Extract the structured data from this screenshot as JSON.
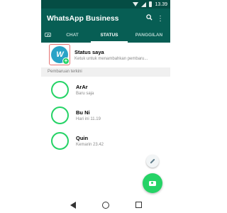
{
  "status_bar": {
    "time": "13.39"
  },
  "app_bar": {
    "title": "WhatsApp Business",
    "search_icon": "🔍",
    "menu_icon": "⋮"
  },
  "tabs": [
    {
      "label": ""
    },
    {
      "label": "CHAT"
    },
    {
      "label": "STATUS",
      "active": true
    },
    {
      "label": "PANGGILAN"
    }
  ],
  "my_status": {
    "avatar_text": "W",
    "add_badge": "+",
    "title": "Status saya",
    "subtitle": "Ketuk untuk menambahkan pembaru..."
  },
  "section_header": "Pembaruan terkini",
  "updates": [
    {
      "name": "ArAr",
      "time": "Baru saja"
    },
    {
      "name": "Bu Ni",
      "time": "Hari ini 11.19"
    },
    {
      "name": "Quin",
      "time": "Kemarin 23.42"
    }
  ],
  "colors": {
    "primary": "#075e54",
    "status_bar": "#054d44",
    "accent": "#25d366",
    "avatar": "#29a3c7"
  },
  "icons": {
    "fab_small": "pencil-icon",
    "fab_large": "camera-icon",
    "nav": [
      "back-icon",
      "home-icon",
      "recents-icon"
    ]
  }
}
